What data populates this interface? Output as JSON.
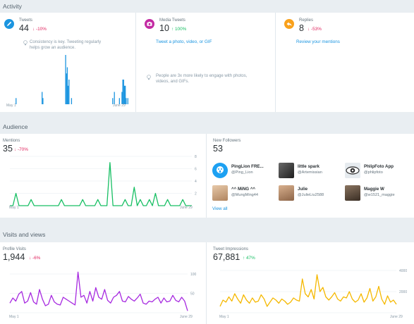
{
  "activity": {
    "title": "Activity",
    "tweets": {
      "label": "Tweets",
      "value": "44",
      "delta": "-10%",
      "delta_dir": "down",
      "tip": [
        "Consistency is key. Tweeting regularly",
        "helps grow an audience."
      ],
      "date_start": "May 1",
      "date_end": "June 29"
    },
    "media": {
      "label": "Media Tweets",
      "value": "10",
      "delta": "100%",
      "delta_dir": "up",
      "link": "Tweet a photo, video, or GIF",
      "tip": [
        "People are 3x more likely to engage with photos,",
        "videos, and GIFs."
      ]
    },
    "replies": {
      "label": "Replies",
      "value": "8",
      "delta": "-53%",
      "delta_dir": "down",
      "link": "Review your mentions"
    }
  },
  "audience": {
    "title": "Audience",
    "mentions": {
      "label": "Mentions",
      "value": "35",
      "delta": "-70%",
      "delta_dir": "down",
      "date_start": "May 1",
      "date_end": "June 29"
    },
    "followers": {
      "label": "New Followers",
      "value": "53",
      "view_all": "View all",
      "items": [
        {
          "name": "PingLion FRE...",
          "handle": "@Ping_Lion",
          "avatar_color": "#1da1f2"
        },
        {
          "name": "little spark",
          "handle": "@Artemissian",
          "avatar_color": "#3a3a3a"
        },
        {
          "name": "PhlipFoto App",
          "handle": "@phlipfoto",
          "avatar_color": "#d8e0e6"
        },
        {
          "name": "^^ MiNG ^^",
          "handle": "@MungMing44",
          "avatar_color": "#c9a98a"
        },
        {
          "name": "Julie",
          "handle": "@JulieLiu2588",
          "avatar_color": "#b48d70"
        },
        {
          "name": "Maggie W",
          "handle": "@w1521_maggie",
          "avatar_color": "#5a4a3a"
        }
      ]
    }
  },
  "visits": {
    "title": "Visits and views",
    "profile": {
      "label": "Profile Visits",
      "value": "1,944",
      "delta": "-6%",
      "delta_dir": "down",
      "date_start": "May 1",
      "date_end": "June 29"
    },
    "impressions": {
      "label": "Tweet Impressions",
      "value": "67,881",
      "delta": "47%",
      "delta_dir": "up",
      "date_start": "May 1",
      "date_end": "June 29"
    }
  },
  "colors": {
    "blue": "#1b95e0",
    "green": "#17bf63",
    "purple": "#a72ae0",
    "gold": "#f5b800",
    "red": "#e0245e",
    "orange": "#f9a11b",
    "pink": "#c32aa3"
  },
  "chart_data": [
    {
      "type": "bar",
      "title": "Tweets",
      "x": [
        "May 1",
        "…",
        "June 29"
      ],
      "values": [
        0,
        0,
        0,
        0,
        0,
        0,
        0,
        0,
        0,
        0,
        0,
        1,
        0,
        0,
        0,
        0,
        0,
        0,
        0,
        0,
        0,
        0,
        0,
        0,
        0,
        0,
        0,
        0,
        0,
        0,
        0,
        0,
        0,
        0,
        0,
        0,
        0,
        0,
        0,
        0,
        0,
        0,
        2,
        1,
        0,
        0,
        0,
        0,
        0,
        0,
        0,
        0,
        0,
        0,
        0,
        0,
        0,
        0,
        0,
        0,
        0,
        0,
        0,
        0,
        0,
        0,
        0,
        0,
        0,
        0,
        8,
        5,
        6,
        3,
        4,
        0,
        0,
        1,
        0,
        0,
        0,
        0,
        0,
        0,
        0,
        0,
        0,
        0,
        0,
        0,
        0,
        0,
        0,
        0,
        0,
        0,
        0,
        0,
        0,
        0,
        0,
        0,
        0,
        0,
        0,
        0,
        0,
        0,
        0,
        0,
        0,
        0,
        0,
        0,
        0,
        0,
        0,
        0,
        0,
        0,
        0,
        0,
        0,
        0,
        0,
        0,
        1,
        0,
        2,
        0,
        0,
        0,
        0,
        0,
        1,
        0,
        0,
        2,
        4,
        4,
        3,
        3,
        1,
        0,
        1,
        0
      ],
      "ylim": [
        0,
        8
      ]
    },
    {
      "type": "line",
      "title": "Mentions",
      "values": [
        0,
        0,
        2,
        0,
        0,
        0,
        0,
        1,
        0,
        0,
        0,
        0,
        0,
        0,
        0,
        0,
        0,
        1,
        0,
        0,
        0,
        0,
        0,
        0,
        1,
        0,
        0,
        0,
        0,
        1,
        0,
        0,
        0,
        7,
        0,
        0,
        0,
        0,
        1,
        0,
        0,
        3,
        0,
        1,
        0,
        0,
        1,
        0,
        2,
        0,
        0,
        0,
        1,
        0,
        0,
        0,
        0,
        1,
        0,
        0,
        0
      ],
      "ylim": [
        0,
        8
      ],
      "yticks": [
        2,
        4,
        6,
        8
      ]
    },
    {
      "type": "line",
      "title": "Profile Visits",
      "values": [
        25,
        38,
        30,
        48,
        55,
        25,
        30,
        52,
        28,
        22,
        60,
        35,
        18,
        22,
        45,
        28,
        22,
        20,
        40,
        35,
        30,
        25,
        20,
        105,
        40,
        45,
        25,
        55,
        30,
        65,
        40,
        35,
        60,
        32,
        25,
        40,
        45,
        55,
        30,
        28,
        42,
        35,
        30,
        38,
        48,
        25,
        22,
        30,
        28,
        35,
        40,
        25,
        38,
        28,
        30,
        45,
        32,
        28,
        40,
        30,
        5
      ],
      "ylim": [
        0,
        120
      ],
      "yticks": [
        50,
        100
      ]
    },
    {
      "type": "line",
      "title": "Tweet Impressions",
      "values": [
        600,
        1200,
        1000,
        1500,
        1100,
        1800,
        1300,
        900,
        1700,
        1200,
        900,
        1400,
        1000,
        1100,
        1700,
        1300,
        600,
        1000,
        1400,
        1200,
        900,
        1300,
        1100,
        800,
        1000,
        1400,
        1200,
        1100,
        3200,
        1800,
        1500,
        2200,
        1300,
        3600,
        2000,
        2400,
        1500,
        1200,
        1500,
        1900,
        1300,
        1100,
        1500,
        1400,
        2000,
        1300,
        1000,
        1200,
        1800,
        1000,
        1400,
        2300,
        1100,
        1500,
        2500,
        1300,
        800,
        1600,
        1000,
        1200,
        800
      ],
      "ylim": [
        0,
        4400
      ],
      "yticks": [
        2000,
        4000
      ]
    }
  ]
}
